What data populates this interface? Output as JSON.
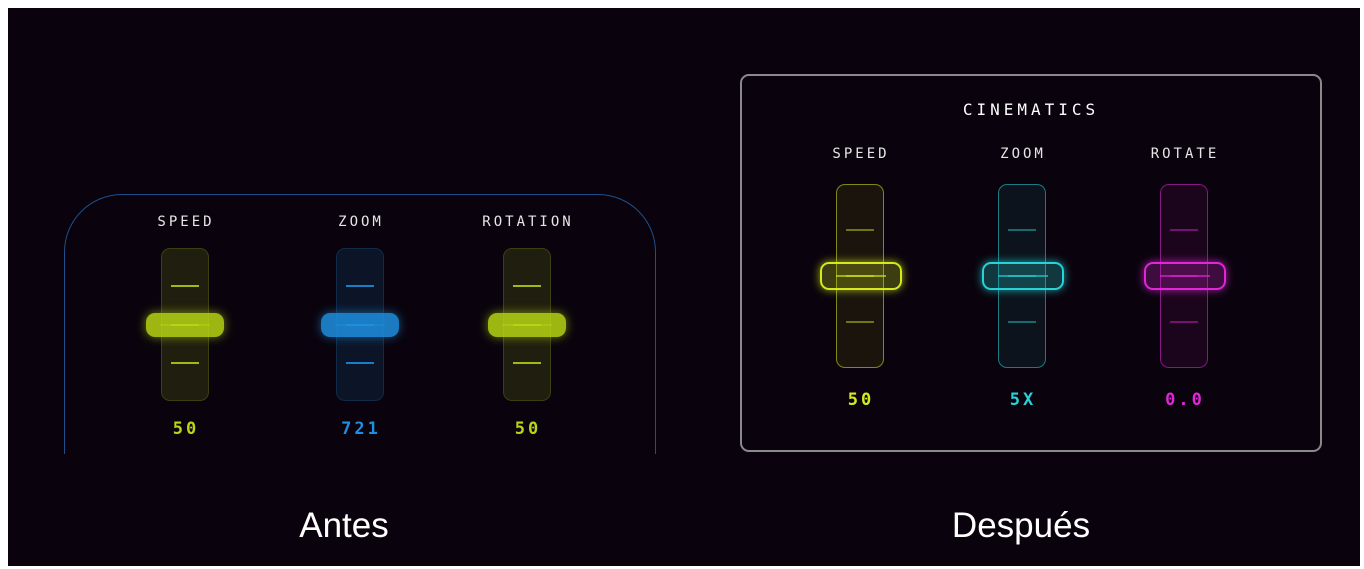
{
  "before": {
    "caption": "Antes",
    "sliders": [
      {
        "label": "SPEED",
        "value": "50",
        "color": "#b8d614",
        "level": 0.5
      },
      {
        "label": "ZOOM",
        "value": "721",
        "color": "#1e8fe0",
        "level": 0.5
      },
      {
        "label": "ROTATION",
        "value": "50",
        "color": "#b8d614",
        "level": 0.5
      }
    ]
  },
  "after": {
    "title": "CINEMATICS",
    "caption": "Después",
    "sliders": [
      {
        "label": "SPEED",
        "value": "50",
        "color": "#d4ea1c",
        "level": 0.5
      },
      {
        "label": "ZOOM",
        "value": "5X",
        "color": "#27d3d6",
        "level": 0.5
      },
      {
        "label": "ROTATE",
        "value": "0.0",
        "color": "#e026d8",
        "level": 0.5
      }
    ]
  }
}
